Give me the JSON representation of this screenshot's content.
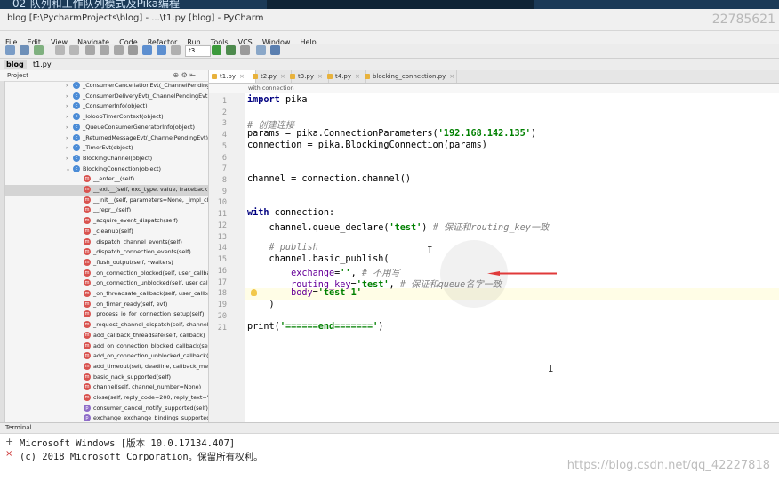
{
  "video_title": "02-队列和工作队列模式及Pika编程",
  "window_title": "blog [F:\\PycharmProjects\\blog] - ...\\t1.py [blog] - PyCharm",
  "overlay_number": "22785621",
  "menu": [
    "File",
    "Edit",
    "View",
    "Navigate",
    "Code",
    "Refactor",
    "Run",
    "Tools",
    "VCS",
    "Window",
    "Help"
  ],
  "run_config": "t3",
  "breadcrumbs": [
    "blog",
    "t1.py"
  ],
  "sidebar": {
    "header": "Project",
    "rows": [
      {
        "kind": "c",
        "label": "_ConsumerCancellationEvt(_ChannelPendingEvt)",
        "arrow": "›"
      },
      {
        "kind": "c",
        "label": "_ConsumerDeliveryEvt(_ChannelPendingEvt)",
        "arrow": "›"
      },
      {
        "kind": "c",
        "label": "_ConsumerInfo(object)",
        "arrow": "›"
      },
      {
        "kind": "c",
        "label": "_IoloopTimerContext(object)",
        "arrow": "›"
      },
      {
        "kind": "c",
        "label": "_QueueConsumerGeneratorInfo(object)",
        "arrow": "›"
      },
      {
        "kind": "c",
        "label": "_ReturnedMessageEvt(_ChannelPendingEvt)",
        "arrow": "›"
      },
      {
        "kind": "c",
        "label": "_TimerEvt(object)",
        "arrow": "›"
      },
      {
        "kind": "c",
        "label": "BlockingChannel(object)",
        "arrow": "›"
      },
      {
        "kind": "c",
        "label": "BlockingConnection(object)",
        "arrow": "⌄"
      },
      {
        "kind": "m",
        "label": "__enter__(self)",
        "arrow": ""
      },
      {
        "kind": "m",
        "label": "__exit__(self, exc_type, value, traceback)",
        "arrow": "",
        "selected": true
      },
      {
        "kind": "m",
        "label": "__init__(self, parameters=None, _impl_class=None)",
        "arrow": ""
      },
      {
        "kind": "m",
        "label": "__repr__(self)",
        "arrow": ""
      },
      {
        "kind": "m",
        "label": "_acquire_event_dispatch(self)",
        "arrow": ""
      },
      {
        "kind": "m",
        "label": "_cleanup(self)",
        "arrow": ""
      },
      {
        "kind": "m",
        "label": "_dispatch_channel_events(self)",
        "arrow": ""
      },
      {
        "kind": "m",
        "label": "_dispatch_connection_events(self)",
        "arrow": ""
      },
      {
        "kind": "m",
        "label": "_flush_output(self, *waiters)",
        "arrow": ""
      },
      {
        "kind": "m",
        "label": "_on_connection_blocked(self, user_callback)",
        "arrow": ""
      },
      {
        "kind": "m",
        "label": "_on_connection_unblocked(self, user callback)",
        "arrow": ""
      },
      {
        "kind": "m",
        "label": "_on_threadsafe_callback(self, user_callback)",
        "arrow": ""
      },
      {
        "kind": "m",
        "label": "_on_timer_ready(self, evt)",
        "arrow": ""
      },
      {
        "kind": "m",
        "label": "_process_io_for_connection_setup(self)",
        "arrow": ""
      },
      {
        "kind": "m",
        "label": "_request_channel_dispatch(self, channel_number)",
        "arrow": ""
      },
      {
        "kind": "m",
        "label": "add_callback_threadsafe(self, callback)",
        "arrow": ""
      },
      {
        "kind": "m",
        "label": "add_on_connection_blocked_callback(self, callback)",
        "arrow": ""
      },
      {
        "kind": "m",
        "label": "add_on_connection_unblocked_callback(self, callback)",
        "arrow": ""
      },
      {
        "kind": "m",
        "label": "add_timeout(self, deadline, callback_method)",
        "arrow": ""
      },
      {
        "kind": "m",
        "label": "basic_nack_supported(self)",
        "arrow": ""
      },
      {
        "kind": "m",
        "label": "channel(self, channel_number=None)",
        "arrow": ""
      },
      {
        "kind": "m",
        "label": "close(self, reply_code=200, reply_text='Normal shutdown')",
        "arrow": ""
      },
      {
        "kind": "p",
        "label": "consumer_cancel_notify_supported(self)",
        "arrow": ""
      },
      {
        "kind": "p",
        "label": "exchange_exchange_bindings_supported(self)",
        "arrow": ""
      }
    ]
  },
  "tabs": [
    "t1.py",
    "t2.py",
    "t3.py",
    "t4.py",
    "blocking_connection.py"
  ],
  "editor_crumb": "with connection",
  "terminal": {
    "title": "Terminal",
    "lines": [
      "Microsoft Windows [版本 10.0.17134.407]",
      "(c) 2018 Microsoft Corporation。保留所有权利。"
    ]
  },
  "csdn_watermark": "https://blog.csdn.net/qq_42227818",
  "colors": {
    "keyword": "#000080",
    "string": "#008000",
    "comment": "#808080",
    "kwarg": "#660099",
    "arrow": "#e03a3a"
  }
}
